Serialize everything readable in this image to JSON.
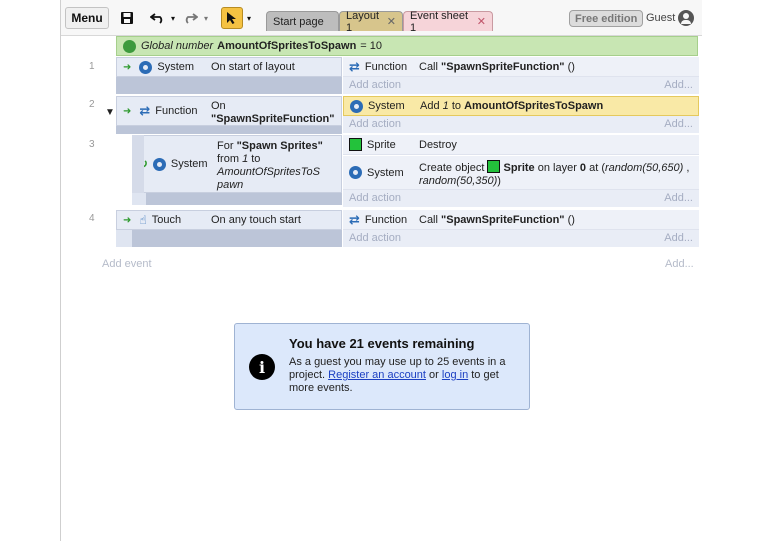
{
  "toolbar": {
    "menu_label": "Menu",
    "tabs": [
      {
        "label": "Start page"
      },
      {
        "label": "Layout 1"
      },
      {
        "label": "Event sheet 1"
      }
    ],
    "free_edition": "Free edition",
    "guest_label": "Guest"
  },
  "global_var": {
    "prefix": "Global number",
    "name": "AmountOfSpritesToSpawn",
    "value_text": "= 10"
  },
  "events": [
    {
      "number": "1",
      "condition_object": "System",
      "condition_text": "On start of layout",
      "actions": [
        {
          "object": "Function",
          "text_prefix": "Call ",
          "text_bold": "\"SpawnSpriteFunction\"",
          "text_suffix": " ()"
        }
      ]
    },
    {
      "number": "2",
      "condition_object": "Function",
      "condition_line1": "On",
      "condition_line2": "\"SpawnSpriteFunction\"",
      "actions": [
        {
          "object": "System",
          "text_prefix": "Add ",
          "text_italic": "1",
          "text_mid": " to ",
          "text_bold": "AmountOfSpritesToSpawn"
        }
      ]
    },
    {
      "number": "3",
      "condition_object": "System",
      "for_prefix": "For ",
      "for_name": "\"Spawn Sprites\"",
      "for_from": "from ",
      "for_from_val": "1",
      "for_to": " to",
      "for_var1": "AmountOfSpritesToS",
      "for_var2": "pawn",
      "actions": [
        {
          "object": "Sprite",
          "text": "Destroy"
        },
        {
          "object": "System",
          "text_prefix": "Create object ",
          "sprite_name": "Sprite",
          "text_mid": " on layer ",
          "layer": "0",
          "text_at": " at (",
          "pos_x": "random(50,650)",
          "comma": " ,",
          "pos_y": "random(50,350)",
          "close": ")"
        }
      ]
    },
    {
      "number": "4",
      "condition_object": "Touch",
      "condition_text": "On any touch start",
      "actions": [
        {
          "object": "Function",
          "text_prefix": "Call ",
          "text_bold": "\"SpawnSpriteFunction\"",
          "text_suffix": " ()"
        }
      ]
    }
  ],
  "add_action_label": "Add action",
  "add_ellipsis": "Add...",
  "add_event_label": "Add event",
  "notice": {
    "title": "You have 21 events remaining",
    "line1": "As a guest you may use up to 25 events in a project. ",
    "register_link": "Register an account",
    "or": " or ",
    "login_link": "log in",
    "line2": " to get more events."
  },
  "colors": {
    "global_bar": "#c8e6b3",
    "highlight_action": "#f9e9a6",
    "select_tool": "#f5c242",
    "event_tab": "#f6d4d9"
  }
}
